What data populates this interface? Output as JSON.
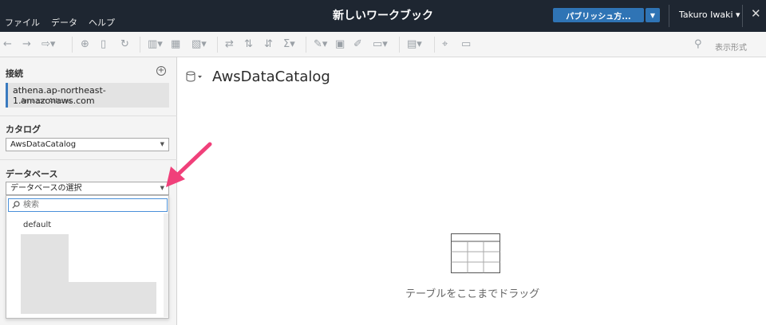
{
  "titlebar": {
    "menu": [
      "ファイル",
      "データ",
      "ヘルプ"
    ],
    "title": "新しいワークブック",
    "publish_label": "パブリッシュ方...",
    "user": "Takuro Iwaki ▾"
  },
  "toolbar": {
    "show_me_label": "表示形式"
  },
  "left_panel": {
    "connections_title": "接続",
    "connection": {
      "name": "athena.ap-northeast-1.amazonaws.com",
      "type": "Amazon Athena"
    },
    "catalog_title": "カタログ",
    "catalog_value": "AwsDataCatalog",
    "database_title": "データベース",
    "database_value": "データベースの選択",
    "dropdown": {
      "search_placeholder": "検索",
      "options": [
        "default"
      ]
    }
  },
  "main": {
    "title": "AwsDataCatalog",
    "drag_hint": "テーブルをここまでドラッグ"
  },
  "colors": {
    "titlebar_bg": "#1e2631",
    "publish_bg": "#2f74b5",
    "accent_annotation": "#f0407a",
    "connection_border": "#3a7bbf"
  },
  "icons": [
    "undo-icon",
    "redo-icon",
    "new-datasource-icon",
    "refresh-icon",
    "add-circle-icon",
    "database-icon",
    "search-icon",
    "table-icon",
    "annotation-arrow"
  ]
}
